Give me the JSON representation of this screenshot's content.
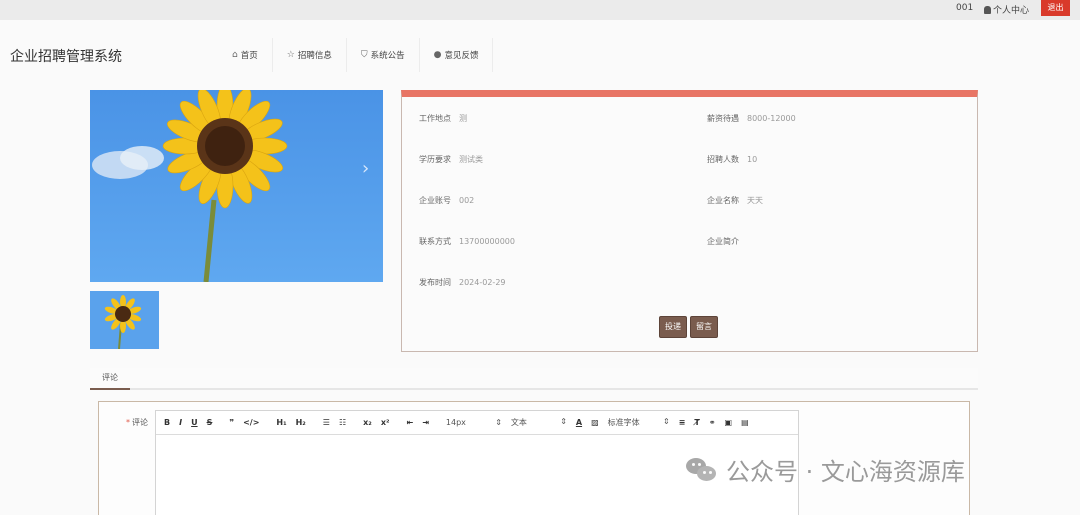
{
  "topbar": {
    "user": "001",
    "profile_label": "个人中心",
    "logout_label": "退出"
  },
  "header": {
    "brand": "企业招聘管理系统",
    "nav": [
      {
        "icon": "home-icon",
        "glyph": "⌂",
        "label": "首页"
      },
      {
        "icon": "star-icon",
        "glyph": "☆",
        "label": "招聘信息"
      },
      {
        "icon": "lock-icon",
        "glyph": "⛉",
        "label": "系统公告"
      },
      {
        "icon": "info-icon",
        "glyph": "●",
        "label": "意见反馈"
      }
    ]
  },
  "detail": {
    "fields": [
      {
        "label": "工作地点",
        "value": "测"
      },
      {
        "label": "薪资待遇",
        "value": "8000-12000"
      },
      {
        "label": "学历要求",
        "value": "测试类"
      },
      {
        "label": "招聘人数",
        "value": "10"
      },
      {
        "label": "企业账号",
        "value": "002"
      },
      {
        "label": "企业名称",
        "value": "天天"
      },
      {
        "label": "联系方式",
        "value": "13700000000"
      },
      {
        "label": "企业简介",
        "value": ""
      },
      {
        "label": "发布时间",
        "value": "2024-02-29"
      }
    ],
    "apply_label": "投递",
    "message_label": "留言"
  },
  "tabs": [
    {
      "label": "评论"
    }
  ],
  "comment_form": {
    "label": "评论",
    "required_mark": "*",
    "toolbar": {
      "bold": "B",
      "italic": "I",
      "underline": "U",
      "strike": "S",
      "quote": "❞",
      "code": "</>",
      "h1": "H₁",
      "h2": "H₂",
      "ordered_list": "☰",
      "bullet_list": "☷",
      "subscript": "x₂",
      "superscript": "x²",
      "indent_left": "⇤",
      "indent_right": "⇥",
      "font_size": "14px",
      "paragraph": "文本",
      "font_family": "标准字体",
      "color": "A",
      "align": "≡",
      "clear": "T̸",
      "link": "🔗",
      "image": "▣",
      "video": "▤"
    }
  },
  "watermark": {
    "text": "公众号 · 文心海资源库"
  }
}
